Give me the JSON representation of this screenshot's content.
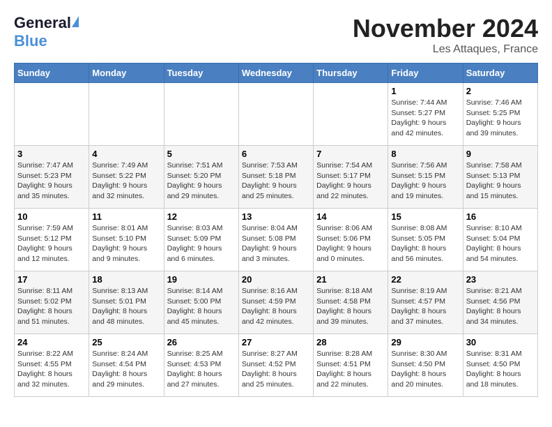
{
  "header": {
    "logo_line1": "General",
    "logo_line2": "Blue",
    "month_title": "November 2024",
    "location": "Les Attaques, France"
  },
  "weekdays": [
    "Sunday",
    "Monday",
    "Tuesday",
    "Wednesday",
    "Thursday",
    "Friday",
    "Saturday"
  ],
  "weeks": [
    [
      {
        "day": "",
        "info": ""
      },
      {
        "day": "",
        "info": ""
      },
      {
        "day": "",
        "info": ""
      },
      {
        "day": "",
        "info": ""
      },
      {
        "day": "",
        "info": ""
      },
      {
        "day": "1",
        "info": "Sunrise: 7:44 AM\nSunset: 5:27 PM\nDaylight: 9 hours and 42 minutes."
      },
      {
        "day": "2",
        "info": "Sunrise: 7:46 AM\nSunset: 5:25 PM\nDaylight: 9 hours and 39 minutes."
      }
    ],
    [
      {
        "day": "3",
        "info": "Sunrise: 7:47 AM\nSunset: 5:23 PM\nDaylight: 9 hours and 35 minutes."
      },
      {
        "day": "4",
        "info": "Sunrise: 7:49 AM\nSunset: 5:22 PM\nDaylight: 9 hours and 32 minutes."
      },
      {
        "day": "5",
        "info": "Sunrise: 7:51 AM\nSunset: 5:20 PM\nDaylight: 9 hours and 29 minutes."
      },
      {
        "day": "6",
        "info": "Sunrise: 7:53 AM\nSunset: 5:18 PM\nDaylight: 9 hours and 25 minutes."
      },
      {
        "day": "7",
        "info": "Sunrise: 7:54 AM\nSunset: 5:17 PM\nDaylight: 9 hours and 22 minutes."
      },
      {
        "day": "8",
        "info": "Sunrise: 7:56 AM\nSunset: 5:15 PM\nDaylight: 9 hours and 19 minutes."
      },
      {
        "day": "9",
        "info": "Sunrise: 7:58 AM\nSunset: 5:13 PM\nDaylight: 9 hours and 15 minutes."
      }
    ],
    [
      {
        "day": "10",
        "info": "Sunrise: 7:59 AM\nSunset: 5:12 PM\nDaylight: 9 hours and 12 minutes."
      },
      {
        "day": "11",
        "info": "Sunrise: 8:01 AM\nSunset: 5:10 PM\nDaylight: 9 hours and 9 minutes."
      },
      {
        "day": "12",
        "info": "Sunrise: 8:03 AM\nSunset: 5:09 PM\nDaylight: 9 hours and 6 minutes."
      },
      {
        "day": "13",
        "info": "Sunrise: 8:04 AM\nSunset: 5:08 PM\nDaylight: 9 hours and 3 minutes."
      },
      {
        "day": "14",
        "info": "Sunrise: 8:06 AM\nSunset: 5:06 PM\nDaylight: 9 hours and 0 minutes."
      },
      {
        "day": "15",
        "info": "Sunrise: 8:08 AM\nSunset: 5:05 PM\nDaylight: 8 hours and 56 minutes."
      },
      {
        "day": "16",
        "info": "Sunrise: 8:10 AM\nSunset: 5:04 PM\nDaylight: 8 hours and 54 minutes."
      }
    ],
    [
      {
        "day": "17",
        "info": "Sunrise: 8:11 AM\nSunset: 5:02 PM\nDaylight: 8 hours and 51 minutes."
      },
      {
        "day": "18",
        "info": "Sunrise: 8:13 AM\nSunset: 5:01 PM\nDaylight: 8 hours and 48 minutes."
      },
      {
        "day": "19",
        "info": "Sunrise: 8:14 AM\nSunset: 5:00 PM\nDaylight: 8 hours and 45 minutes."
      },
      {
        "day": "20",
        "info": "Sunrise: 8:16 AM\nSunset: 4:59 PM\nDaylight: 8 hours and 42 minutes."
      },
      {
        "day": "21",
        "info": "Sunrise: 8:18 AM\nSunset: 4:58 PM\nDaylight: 8 hours and 39 minutes."
      },
      {
        "day": "22",
        "info": "Sunrise: 8:19 AM\nSunset: 4:57 PM\nDaylight: 8 hours and 37 minutes."
      },
      {
        "day": "23",
        "info": "Sunrise: 8:21 AM\nSunset: 4:56 PM\nDaylight: 8 hours and 34 minutes."
      }
    ],
    [
      {
        "day": "24",
        "info": "Sunrise: 8:22 AM\nSunset: 4:55 PM\nDaylight: 8 hours and 32 minutes."
      },
      {
        "day": "25",
        "info": "Sunrise: 8:24 AM\nSunset: 4:54 PM\nDaylight: 8 hours and 29 minutes."
      },
      {
        "day": "26",
        "info": "Sunrise: 8:25 AM\nSunset: 4:53 PM\nDaylight: 8 hours and 27 minutes."
      },
      {
        "day": "27",
        "info": "Sunrise: 8:27 AM\nSunset: 4:52 PM\nDaylight: 8 hours and 25 minutes."
      },
      {
        "day": "28",
        "info": "Sunrise: 8:28 AM\nSunset: 4:51 PM\nDaylight: 8 hours and 22 minutes."
      },
      {
        "day": "29",
        "info": "Sunrise: 8:30 AM\nSunset: 4:50 PM\nDaylight: 8 hours and 20 minutes."
      },
      {
        "day": "30",
        "info": "Sunrise: 8:31 AM\nSunset: 4:50 PM\nDaylight: 8 hours and 18 minutes."
      }
    ]
  ]
}
